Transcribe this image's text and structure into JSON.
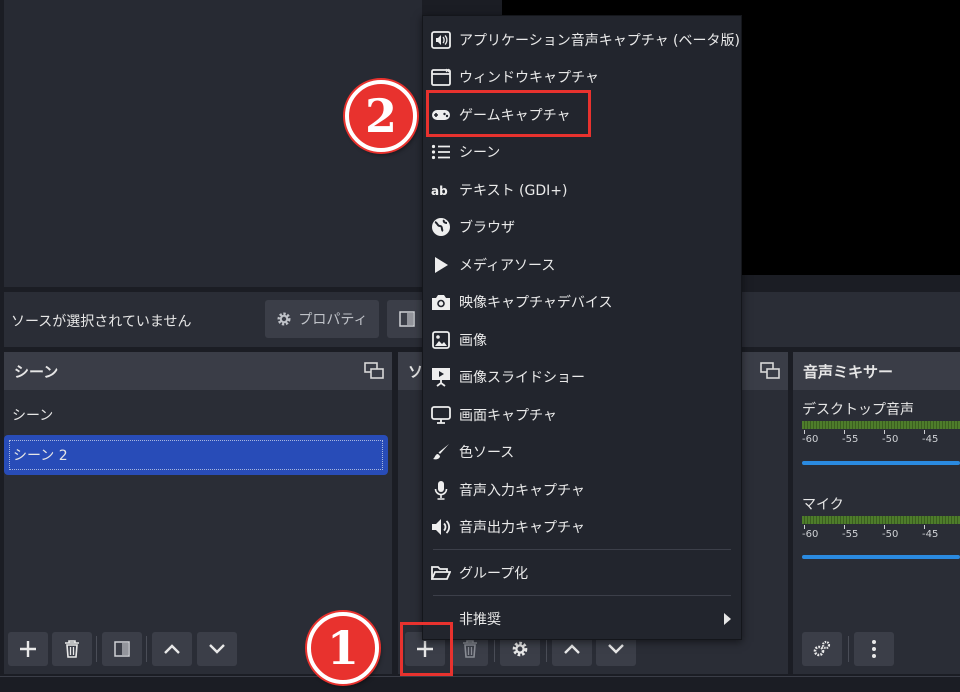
{
  "properties_bar": {
    "no_source_text": "ソースが選択されていません",
    "properties_label": "プロパティ"
  },
  "scenes": {
    "title": "シーン",
    "items": [
      "シーン",
      "シーン 2"
    ],
    "selected_index": 1
  },
  "sources": {
    "title_visible": "ソ"
  },
  "mixer": {
    "title": "音声ミキサー",
    "channels": [
      {
        "name": "デスクトップ音声",
        "ticks": [
          "-60",
          "-55",
          "-50",
          "-45"
        ]
      },
      {
        "name": "マイク",
        "ticks": [
          "-60",
          "-55",
          "-50",
          "-45"
        ]
      }
    ]
  },
  "context_menu": {
    "items": [
      {
        "label": "アプリケーション音声キャプチャ (ベータ版)",
        "icon": "speaker-window-icon"
      },
      {
        "label": "ウィンドウキャプチャ",
        "icon": "window-icon"
      },
      {
        "label": "ゲームキャプチャ",
        "icon": "gamepad-icon"
      },
      {
        "label": "シーン",
        "icon": "list-icon"
      },
      {
        "label": "テキスト (GDI+)",
        "icon": "text-ab-icon"
      },
      {
        "label": "ブラウザ",
        "icon": "globe-icon"
      },
      {
        "label": "メディアソース",
        "icon": "play-icon"
      },
      {
        "label": "映像キャプチャデバイス",
        "icon": "camera-icon"
      },
      {
        "label": "画像",
        "icon": "image-icon"
      },
      {
        "label": "画像スライドショー",
        "icon": "slideshow-icon"
      },
      {
        "label": "画面キャプチャ",
        "icon": "monitor-icon"
      },
      {
        "label": "色ソース",
        "icon": "brush-icon"
      },
      {
        "label": "音声入力キャプチャ",
        "icon": "microphone-icon"
      },
      {
        "label": "音声出力キャプチャ",
        "icon": "speaker-icon"
      },
      {
        "label": "グループ化",
        "icon": "folder-open-icon"
      },
      {
        "label": "非推奨",
        "icon": ""
      }
    ]
  },
  "annotations": {
    "step1": "1",
    "step2": "2",
    "highlight_color": "#e8322e"
  },
  "colors": {
    "selected_scene": "#284cb8",
    "volume_slider": "#2a8ae0",
    "meter_green": "#4e7d2b"
  }
}
